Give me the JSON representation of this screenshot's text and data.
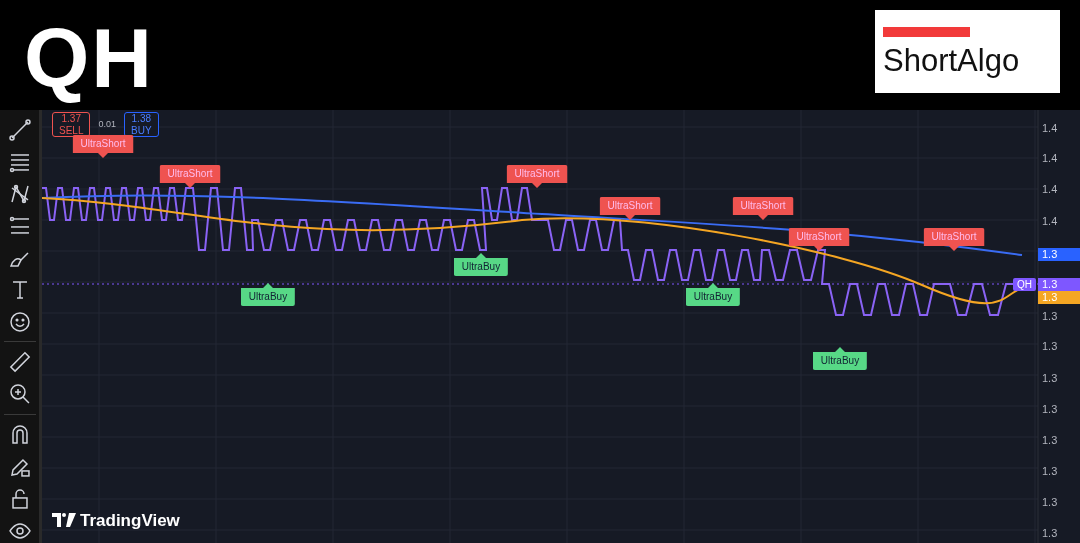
{
  "header": {
    "symbol": "QH",
    "logo": "ShortAlgo"
  },
  "toolbar": {
    "tools": [
      {
        "kind": "line"
      },
      {
        "kind": "fib"
      },
      {
        "kind": "pattern"
      },
      {
        "kind": "long"
      },
      {
        "kind": "brush"
      },
      {
        "kind": "text"
      },
      {
        "kind": "emoji"
      },
      {
        "kind": "ruler"
      },
      {
        "kind": "zoom"
      },
      {
        "kind": "magnet"
      },
      {
        "kind": "lockdraw"
      },
      {
        "kind": "lock"
      },
      {
        "kind": "eye"
      }
    ]
  },
  "trade": {
    "sell_price": "1.37",
    "sell_label": "SELL",
    "spread": "0.01",
    "buy_price": "1.38",
    "buy_label": "BUY"
  },
  "signals": [
    {
      "kind": "short",
      "label": "UltraShort"
    },
    {
      "kind": "short",
      "label": "UltraShort"
    },
    {
      "kind": "buy",
      "label": "UltraBuy"
    },
    {
      "kind": "buy",
      "label": "UltraBuy"
    },
    {
      "kind": "short",
      "label": "UltraShort"
    },
    {
      "kind": "short",
      "label": "UltraShort"
    },
    {
      "kind": "buy",
      "label": "UltraBuy"
    },
    {
      "kind": "short",
      "label": "UltraShort"
    },
    {
      "kind": "short",
      "label": "UltraShort"
    },
    {
      "kind": "buy",
      "label": "UltraBuy"
    },
    {
      "kind": "short",
      "label": "UltraShort"
    }
  ],
  "price_axis": {
    "ticks": [
      "1.4",
      "1.4",
      "1.4",
      "1.4",
      "1.3",
      "1.3",
      "1.3",
      "1.3",
      "1.3",
      "1.3",
      "1.3",
      "1.3"
    ],
    "badges": [
      {
        "text": "1.3",
        "color": "#2962ff"
      },
      {
        "text": "1.3",
        "color": "#7e57ff"
      },
      {
        "text": "1.3",
        "color": "#f5a623"
      }
    ],
    "series_tag": "QH"
  },
  "watermark_logo": "TradingView"
}
